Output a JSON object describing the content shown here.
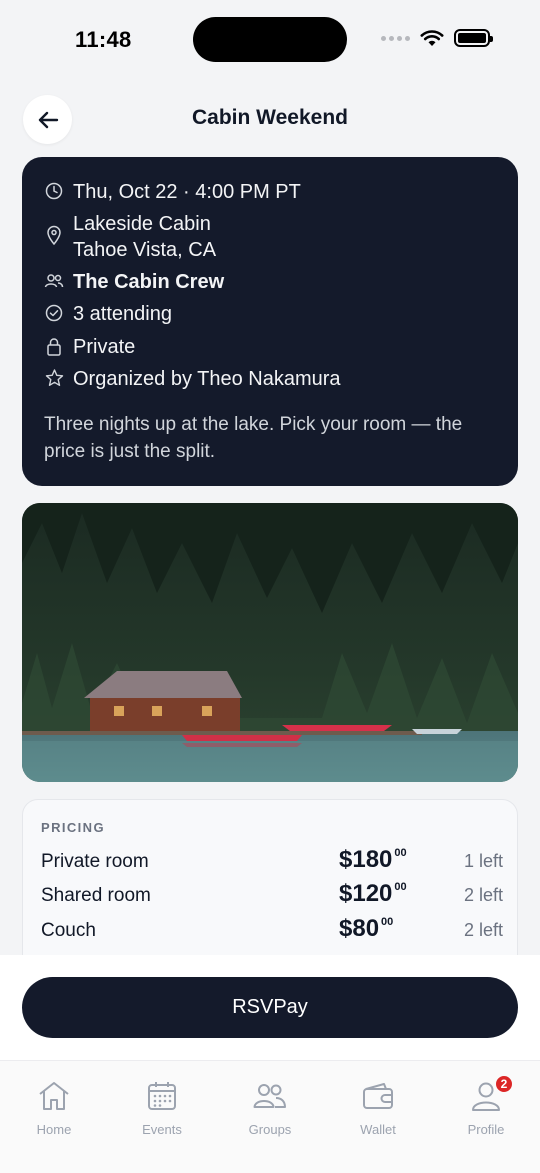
{
  "status_bar": {
    "time": "11:48"
  },
  "header": {
    "title": "Cabin Weekend"
  },
  "event": {
    "datetime": "Thu, Oct 22 · 4:00 PM PT",
    "location_line1": "Lakeside Cabin",
    "location_line2": "Tahoe Vista, CA",
    "group": "The Cabin Crew",
    "attending": "3 attending",
    "privacy": "Private",
    "organizer": "Organized by Theo Nakamura",
    "description": "Three nights up at the lake. Pick your room — the price is just the split."
  },
  "pricing": {
    "label": "PRICING",
    "items": [
      {
        "name": "Private room",
        "dollars": "$180",
        "cents": "00",
        "availability": "1 left"
      },
      {
        "name": "Shared room",
        "dollars": "$120",
        "cents": "00",
        "availability": "2 left"
      },
      {
        "name": "Couch",
        "dollars": "$80",
        "cents": "00",
        "availability": "2 left"
      }
    ]
  },
  "cta": {
    "label": "RSVPay"
  },
  "tabs": [
    {
      "label": "Home",
      "icon": "home-icon"
    },
    {
      "label": "Events",
      "icon": "calendar-icon"
    },
    {
      "label": "Groups",
      "icon": "users-icon"
    },
    {
      "label": "Wallet",
      "icon": "wallet-icon"
    },
    {
      "label": "Profile",
      "icon": "user-icon",
      "badge": "2"
    }
  ],
  "colors": {
    "card_dark": "#141a2b",
    "badge_red": "#dc2626",
    "background": "#f3f4f6"
  }
}
